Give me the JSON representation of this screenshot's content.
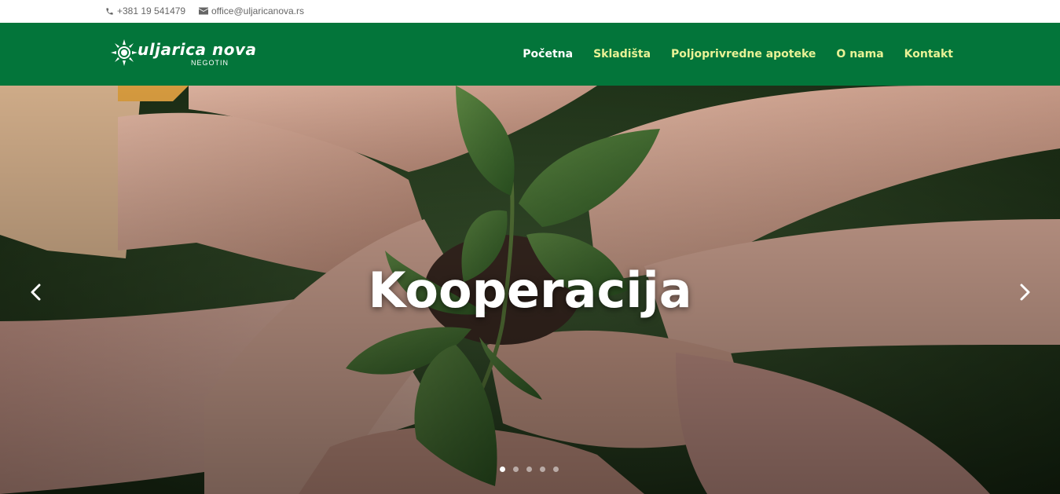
{
  "topbar": {
    "phone": "+381 19 541479",
    "email": "office@uljaricanova.rs",
    "phone_icon": "phone-icon",
    "email_icon": "envelope-icon"
  },
  "header": {
    "logo_main": "uljarica nova",
    "logo_sub": "NEGOTIN",
    "nav": [
      {
        "label": "Početna"
      },
      {
        "label": "Skladišta"
      },
      {
        "label": "Poljoprivredne apoteke"
      },
      {
        "label": "O nama"
      },
      {
        "label": "Kontakt"
      }
    ]
  },
  "hero": {
    "title": "Kooperacija",
    "prev_icon": "chevron-left-icon",
    "next_icon": "chevron-right-icon",
    "slide_count": 5,
    "active_slide": 1
  },
  "colors": {
    "header_bg": "#03753a",
    "nav_text": "#e9f296",
    "nav_active": "#ffffff",
    "topbar_text": "#666666"
  }
}
